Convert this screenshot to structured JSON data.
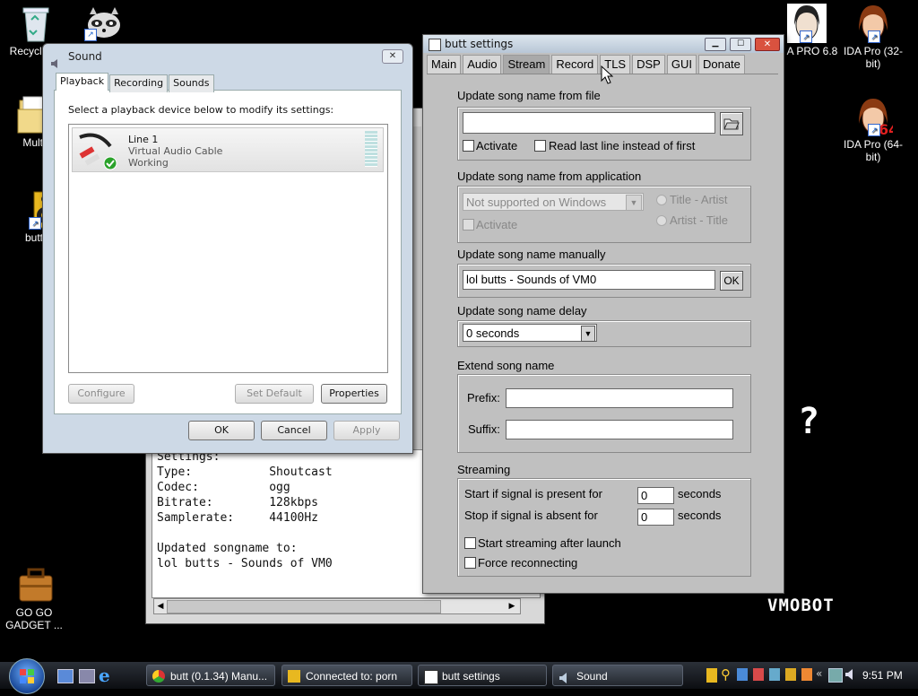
{
  "desktop": {
    "icons": [
      {
        "label": "Recycle"
      },
      {
        "label": "Multi"
      },
      {
        "label": "butt"
      },
      {
        "label": "GO GO GADGET ..."
      },
      {
        "label": "A PRO 6.8"
      },
      {
        "label": "IDA Pro (32-bit)"
      },
      {
        "label": "IDA Pro (64-bit)"
      }
    ],
    "watermark": "VMOBOT",
    "mystery_glyph": "?"
  },
  "sound_dialog": {
    "title": "Sound",
    "tabs": [
      "Playback",
      "Recording",
      "Sounds"
    ],
    "instruction": "Select a playback device below to modify its settings:",
    "device": {
      "name": "Line 1",
      "description": "Virtual Audio Cable",
      "status": "Working"
    },
    "buttons": {
      "configure": "Configure",
      "set_default": "Set Default",
      "properties": "Properties",
      "ok": "OK",
      "cancel": "Cancel",
      "apply": "Apply"
    }
  },
  "console": {
    "lines": [
      "Settings:",
      "Type:           Shoutcast",
      "Codec:          ogg",
      "Bitrate:        128kbps",
      "Samplerate:     44100Hz",
      "",
      "Updated songname to:",
      "lol butts - Sounds of VM0"
    ]
  },
  "butt": {
    "title": "butt settings",
    "tabs": [
      "Main",
      "Audio",
      "Stream",
      "Record",
      "TLS",
      "DSP",
      "GUI",
      "Donate"
    ],
    "file_group": {
      "label": "Update song name from file",
      "path": "",
      "activate": "Activate",
      "read_last": "Read last line instead of first"
    },
    "app_group": {
      "label": "Update song name from application",
      "select": "Not supported on Windows",
      "activate": "Activate",
      "opt1": "Title - Artist",
      "opt2": "Artist - Title"
    },
    "manual_group": {
      "label": "Update song name manually",
      "value": "lol butts - Sounds of VM0",
      "ok": "OK"
    },
    "delay_group": {
      "label": "Update song name delay",
      "value": "0 seconds"
    },
    "extend_group": {
      "label": "Extend song name",
      "prefix_label": "Prefix:",
      "suffix_label": "Suffix:",
      "prefix": "",
      "suffix": ""
    },
    "streaming_group": {
      "label": "Streaming",
      "start_label": "Start if signal is present for",
      "start_value": "0",
      "start_unit": "seconds",
      "stop_label": "Stop if signal is absent for",
      "stop_value": "0",
      "stop_unit": "seconds",
      "after_launch": "Start streaming after launch",
      "force_reconnect": "Force reconnecting"
    }
  },
  "taskbar": {
    "items": [
      {
        "label": "butt (0.1.34) Manu..."
      },
      {
        "label": "Connected to: porn"
      },
      {
        "label": "butt settings"
      },
      {
        "label": "Sound"
      }
    ],
    "clock": "9:51 PM"
  },
  "colors": {
    "desktop": "#000000",
    "butt_bg": "#c0c0c0",
    "vista_frame": "#cdd9e6",
    "taskbar": "#1a1d22"
  }
}
